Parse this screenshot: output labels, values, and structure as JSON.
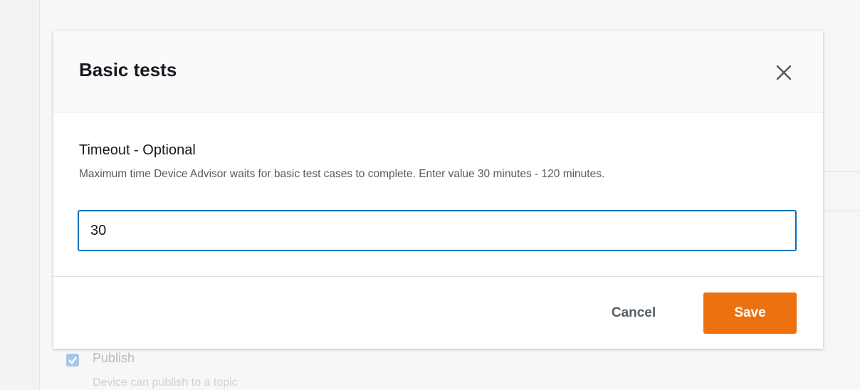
{
  "background": {
    "checkbox_label": "Publish",
    "checkbox_description": "Device can publish to a topic",
    "checkbox_checked": true
  },
  "modal": {
    "title": "Basic tests",
    "close_icon": "close-icon",
    "field": {
      "label": "Timeout - Optional",
      "description": "Maximum time Device Advisor waits for basic test cases to complete. Enter value 30 minutes - 120 minutes.",
      "value": "30"
    },
    "footer": {
      "cancel_label": "Cancel",
      "save_label": "Save"
    }
  },
  "colors": {
    "primary_button": "#ec7211",
    "input_focus_border": "#0073bb",
    "title_text": "#16191f",
    "secondary_text": "#545b64"
  }
}
